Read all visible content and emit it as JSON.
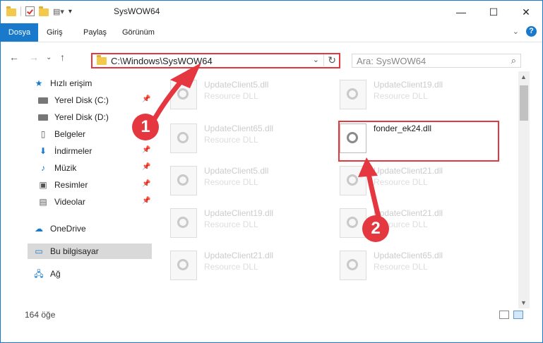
{
  "window": {
    "title": "SysWOW64"
  },
  "ribbon": {
    "tabs": [
      "Dosya",
      "Giriş",
      "Paylaş",
      "Görünüm"
    ],
    "help": "?"
  },
  "nav": {
    "address": "C:\\Windows\\SysWOW64",
    "search_placeholder": "Ara: SysWOW64"
  },
  "sidebar": {
    "items": [
      {
        "label": "Hızlı erişim",
        "icon": "star-icon"
      },
      {
        "label": "Yerel Disk (C:)",
        "icon": "drive-icon"
      },
      {
        "label": "Yerel Disk (D:)",
        "icon": "drive-icon"
      },
      {
        "label": "Belgeler",
        "icon": "documents-icon"
      },
      {
        "label": "İndirmeler",
        "icon": "download-icon"
      },
      {
        "label": "Müzik",
        "icon": "music-icon"
      },
      {
        "label": "Resimler",
        "icon": "pictures-icon"
      },
      {
        "label": "Videolar",
        "icon": "video-icon"
      },
      {
        "label": "OneDrive",
        "icon": "cloud-icon"
      },
      {
        "label": "Bu bilgisayar",
        "icon": "computer-icon"
      },
      {
        "label": "Ağ",
        "icon": "network-icon"
      }
    ]
  },
  "files": [
    {
      "name": "UpdateClient5.dll",
      "type": "Resource DLL"
    },
    {
      "name": "UpdateClient19.dll",
      "type": "Resource DLL"
    },
    {
      "name": "UpdateClient65.dll",
      "type": "Resource DLL"
    },
    {
      "name": "fonder_ek24.dll",
      "type": ""
    },
    {
      "name": "UpdateClient5.dll",
      "type": "Resource DLL"
    },
    {
      "name": "UpdateClient21.dll",
      "type": "Resource DLL"
    },
    {
      "name": "UpdateClient19.dll",
      "type": "Resource DLL"
    },
    {
      "name": "UpdateClient21.dll",
      "type": "Resource DLL"
    },
    {
      "name": "UpdateClient21.dll",
      "type": "Resource DLL"
    },
    {
      "name": "UpdateClient65.dll",
      "type": "Resource DLL"
    }
  ],
  "status": {
    "count": "164 öğe"
  },
  "callouts": [
    "1",
    "2"
  ],
  "colors": {
    "accent": "#1979ca",
    "highlight": "#e4373f"
  }
}
